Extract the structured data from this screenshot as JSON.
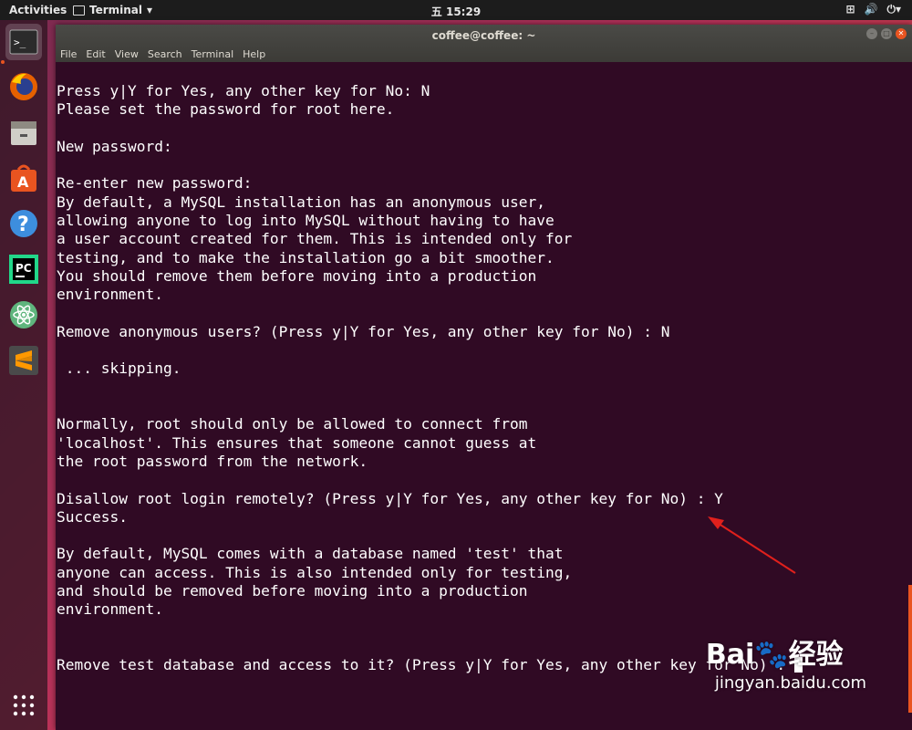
{
  "topbar": {
    "activities": "Activities",
    "app_menu": "Terminal",
    "clock": "五 15:29",
    "tray_icons": [
      "network-icon",
      "volume-icon",
      "power-icon"
    ]
  },
  "dock": {
    "items": [
      "terminal-icon",
      "firefox-icon",
      "files-icon",
      "software-center-icon",
      "help-icon",
      "pycharm-icon",
      "atom-icon",
      "sublime-icon"
    ],
    "show_apps_icon": "app-grid-icon"
  },
  "window": {
    "title": "coffee@coffee: ~",
    "menus": [
      "File",
      "Edit",
      "View",
      "Search",
      "Terminal",
      "Help"
    ]
  },
  "terminal": {
    "lines": [
      "Press y|Y for Yes, any other key for No: N",
      "Please set the password for root here.",
      "",
      "New password:",
      "",
      "Re-enter new password:",
      "By default, a MySQL installation has an anonymous user,",
      "allowing anyone to log into MySQL without having to have",
      "a user account created for them. This is intended only for",
      "testing, and to make the installation go a bit smoother.",
      "You should remove them before moving into a production",
      "environment.",
      "",
      "Remove anonymous users? (Press y|Y for Yes, any other key for No) : N",
      "",
      " ... skipping.",
      "",
      "",
      "Normally, root should only be allowed to connect from",
      "'localhost'. This ensures that someone cannot guess at",
      "the root password from the network.",
      "",
      "Disallow root login remotely? (Press y|Y for Yes, any other key for No) : Y",
      "Success.",
      "",
      "By default, MySQL comes with a database named 'test' that",
      "anyone can access. This is also intended only for testing,",
      "and should be removed before moving into a production",
      "environment.",
      "",
      "",
      "Remove test database and access to it? (Press y|Y for Yes, any other key for No) : "
    ]
  },
  "watermark": {
    "brand": "Bai",
    "brand_tail": "经验",
    "url": "jingyan.baidu.com"
  },
  "colors": {
    "terminal_bg": "#300a24",
    "accent": "#e95420",
    "annotation_arrow": "#e0201c"
  }
}
